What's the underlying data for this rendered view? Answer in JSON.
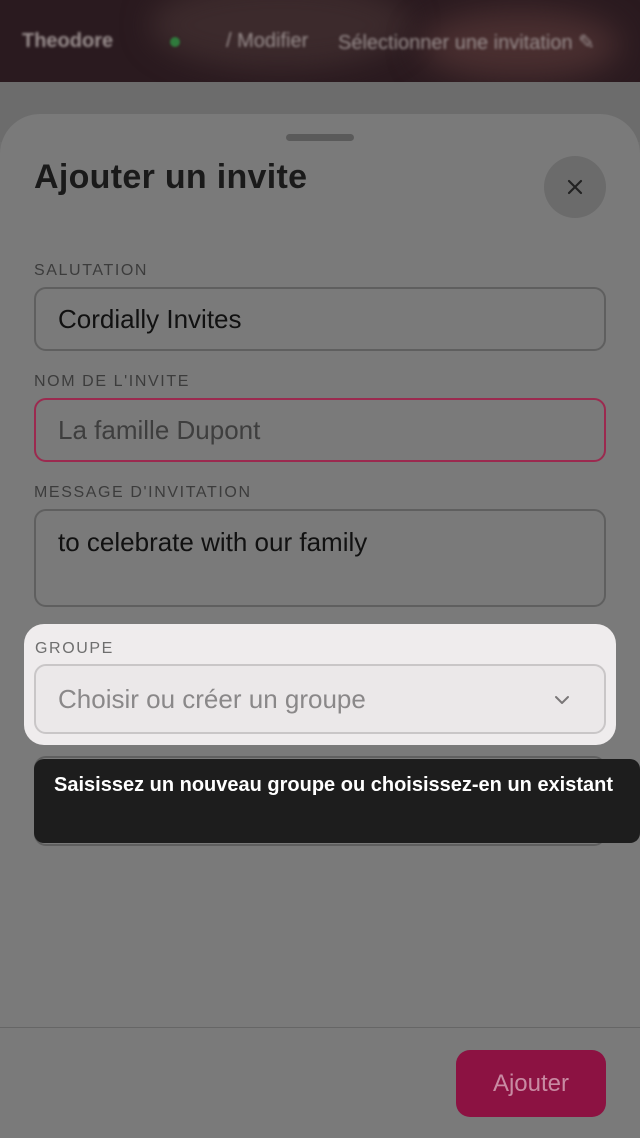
{
  "app_bar": {
    "name": "Theodore",
    "action": "/ Modifier",
    "link": "Sélectionner une invitation ✎"
  },
  "sheet": {
    "title": "Ajouter un invite",
    "close_icon": "close-icon"
  },
  "form": {
    "salutation": {
      "label": "SALUTATION",
      "value": "Cordially Invites"
    },
    "guest_name": {
      "label": "NOM DE L'INVITE",
      "placeholder": "La famille Dupont"
    },
    "message": {
      "label": "MESSAGE D'INVITATION",
      "value": "to celebrate with our family"
    },
    "group": {
      "label": "GROUPE",
      "placeholder": "Choisir ou créer un groupe",
      "icon": "chevron-down-icon"
    }
  },
  "tooltip": {
    "text": "Saisissez un nouveau groupe ou choisissez-en un existant"
  },
  "footer": {
    "submit_label": "Ajouter"
  },
  "colors": {
    "accent": "#8c1242",
    "tooltip_bg": "#1d1d1d",
    "invalid_border": "#9b2a4f"
  }
}
